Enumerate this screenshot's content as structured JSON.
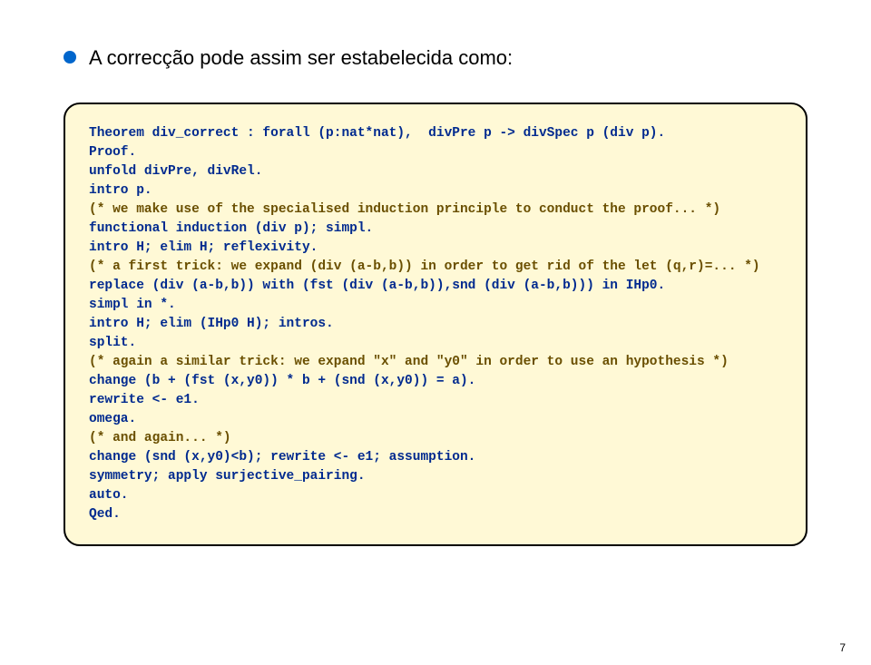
{
  "heading": "A correcção pode assim ser estabelecida como:",
  "code": {
    "l1": "Theorem div_correct : forall (p:nat*nat),  divPre p -> divSpec p (div p).",
    "l2": "Proof.",
    "l3": "unfold divPre, divRel.",
    "l4": "intro p.",
    "l5a": "(* we make use of the specialised induction principle to conduct the proof... *)",
    "l6": "functional induction (div p); simpl.",
    "l7": "intro H; elim H; reflexivity.",
    "l8a": "(* a first trick: we expand (div (a-b,b)) in order to get rid of the let (q,r)=... *)",
    "l9": "replace (div (a-b,b)) with (fst (div (a-b,b)),snd (div (a-b,b))) in IHp0.",
    "l10": "simpl in *.",
    "l11": "intro H; elim (IHp0 H); intros.",
    "l12": "split.",
    "l13a": "(* again a similar trick: we expand \"x\" and \"y0\" in order to use an hypothesis *)",
    "l14": "change (b + (fst (x,y0)) * b + (snd (x,y0)) = a).",
    "l15": "rewrite <- e1.",
    "l16": "omega.",
    "l17a": "(* and again... *)",
    "l18": "change (snd (x,y0)<b); rewrite <- e1; assumption.",
    "l19": "symmetry; apply surjective_pairing.",
    "l20": "auto.",
    "l21": "Qed."
  },
  "page_number": "7"
}
